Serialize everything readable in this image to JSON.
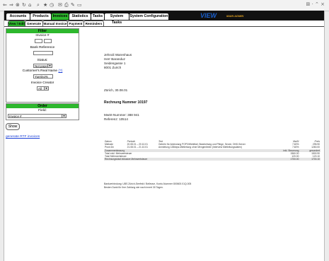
{
  "browser_toolbar": {
    "icons": [
      "back-icon",
      "forward-icon",
      "stop-icon",
      "refresh-icon",
      "home-icon",
      "search-icon",
      "favorites-icon",
      "history-icon",
      "mail-icon",
      "print-icon",
      "edit-icon",
      "discuss-icon"
    ]
  },
  "nav": {
    "tabs": [
      {
        "label": "Accounts",
        "active": false
      },
      {
        "label": "Products",
        "active": false
      },
      {
        "label": "Invoices",
        "active": true
      },
      {
        "label": "Statistics",
        "active": false
      },
      {
        "label": "Tasks",
        "active": false
      },
      {
        "label": "System Tasks",
        "active": false
      },
      {
        "label": "System Configuration",
        "active": false
      }
    ],
    "logo": "VIEW",
    "logo_sub": "MAIN ADMIN"
  },
  "subnav": {
    "tabs": [
      {
        "label": "View / Edit",
        "active": true
      },
      {
        "label": "Generate",
        "active": false
      },
      {
        "label": "Manual Invoice",
        "active": false
      },
      {
        "label": "Payment",
        "active": false
      },
      {
        "label": "Reminders",
        "active": false
      }
    ]
  },
  "filter": {
    "title": "Filter",
    "invoice_label": "Invoice #",
    "invoice_from": "",
    "invoice_to": "",
    "bank_ref_label": "Bank Reference",
    "bank_ref_value": "",
    "status_label": "Status:",
    "status_value": "Not payed",
    "customer_label": "Customer's Real Name",
    "customer_help": "(?)",
    "customer_value": "Yuerino%",
    "creator_label": "Invoice Creator",
    "creator_value": "All"
  },
  "order": {
    "title": "Order",
    "field_label": "Field:",
    "field_value": "Invoice #"
  },
  "show_button": "Show",
  "rtf_link": "generate RTF invoices",
  "invoice": {
    "address": [
      "Jehnoli Warenhaus",
      "Herr Baranduz",
      "Seidengasse 1",
      "8001 Zurich"
    ],
    "place_date": "Zürich, 30.08.01",
    "title": "Rechnung Nummer 10197",
    "vat_number": "MwSt-Nummer: 388 941",
    "reference": "Referenz: 10514",
    "columns": [
      "Datum",
      "Periode",
      "Text",
      "MwSt",
      "Preis"
    ],
    "rows": [
      {
        "date": "Mietrate",
        "period": "20.08.01 – 20.10.01",
        "text": "Gebühr für Anbindung POP3/WebMail, Bearbeitung und Pflege, Server, DNS-Server",
        "vat": "7.60%",
        "price": "295.90",
        "shade": false
      },
      {
        "date": "Pront.Dn",
        "period": "21.08.01 – 21.10.01",
        "text": "Anmietung 128kbps-Mietleitung ohne Mengenlimite (Interview Mietleitungsdaten)",
        "vat": "7.60%",
        "price": "1260.00",
        "shade": false
      }
    ],
    "summary_header": [
      "Zusammenfassung",
      "",
      "",
      "inkl. Steuerung",
      "gesondert"
    ],
    "summary": [
      {
        "label": "Total exkl. Mehrwertsteuer",
        "a": "1560.00",
        "b": "1500.90"
      },
      {
        "label": "Total Mehrwertsteuer",
        "a": "120.00",
        "b": "120.10"
      },
      {
        "label": "Rechnungstotal inklusive Mehrwertsteuer",
        "a": "1700.00",
        "b": "1700.10"
      }
    ],
    "footer": [
      "Bankverbindung: UBS Zürich-Seefeld / Bellevue, Konto-Nummer 800600.01Q.005",
      "Besten Dank für Ihre Zahlung wie nach innert 30 Tagen."
    ]
  }
}
